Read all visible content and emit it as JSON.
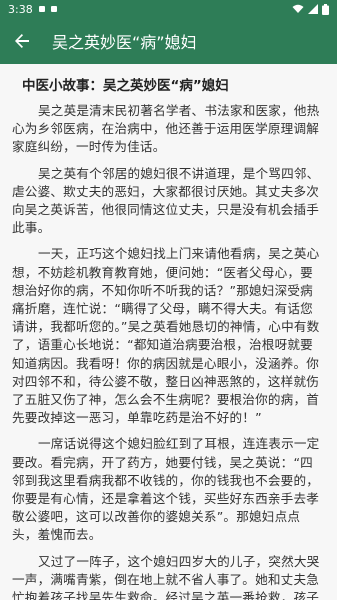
{
  "status_bar": {
    "time": "3:38",
    "icons": [
      "notification-square-icon",
      "notification-square-icon",
      "wifi-icon",
      "signal-icon",
      "battery-icon"
    ]
  },
  "app_bar": {
    "back_icon": "arrow-left-icon",
    "title": "吴之英妙医“病”媳妇"
  },
  "article": {
    "title": "中医小故事：吴之英妙医“病”媳妇",
    "paragraphs": [
      "吴之英是清末民初著名学者、书法家和医家，他热心为乡邻医病，在治病中，他还善于运用医学原理调解家庭纠纷，一时传为佳话。",
      "吴之英有个邻居的媳妇很不讲道理，是个骂四邻、虐公婆、欺丈夫的恶妇，大家都很讨厌她。其丈夫多次向吴之英诉苦，他很同情这位丈夫，只是没有机会插手此事。",
      "一天，正巧这个媳妇找上门来请他看病，吴之英心想，不妨趁机教育教育她，便问她：“医者父母心，要想治好你的病，不知你听不听我的话？”那媳妇深受病痛折磨，连忙说：“瞒得了父母，瞒不得大夫。有话您请讲，我都听您的。”吴之英看她恳切的神情，心中有数了，语重心长地说：“都知道治病要治根，治根呀就要知道病因。我看呀！你的病因就是心眼小，没涵养。你对四邻不和，待公婆不敬，整日凶神恶煞的，这样就伤了五脏又伤了神，怎么会不生病呢？要根治你的病，首先要改掉这一恶习，单靠吃药是治不好的！”",
      "一席话说得这个媳妇脸红到了耳根，连连表示一定要改。看完病，开了药方，她要付钱，吴之英说：“四邻到我这里看病我都不收钱的，你的钱我也不会要的，你要是有心情，还是拿着这个钱，买些好东西亲手去孝敬公婆吧，这可以改善你的婆媳关系”。那媳妇点点头，羞愧而去。",
      "又过了一阵子，这个媳妇四岁大的儿子，突然大哭一声，满嘴青紫，倒在地上就不省人事了。她和丈夫急忙抱着孩子找吴先生救命。经过吴之英一番抢救，孩子总算苏醒了，这媳妇又是作揖又是磕头，感激不尽。"
    ]
  },
  "colors": {
    "primary": "#2e7d57",
    "background": "#f7f7f7",
    "text": "#333333"
  }
}
